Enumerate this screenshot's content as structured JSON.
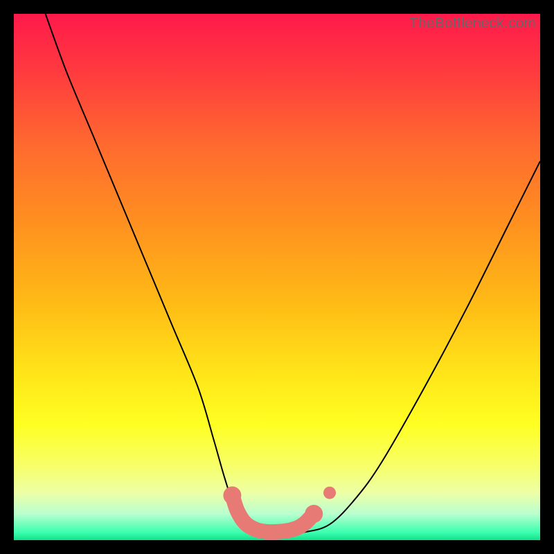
{
  "watermark": {
    "text": "TheBottleneck.com"
  },
  "colors": {
    "curve": "#000000",
    "marker_fill": "#e77a74",
    "marker_stroke": "#e77a74",
    "gradient_stops": [
      {
        "offset": 0.0,
        "color": "#ff1a4b"
      },
      {
        "offset": 0.1,
        "color": "#ff3740"
      },
      {
        "offset": 0.25,
        "color": "#ff6a2f"
      },
      {
        "offset": 0.4,
        "color": "#ff911f"
      },
      {
        "offset": 0.55,
        "color": "#ffbb16"
      },
      {
        "offset": 0.68,
        "color": "#ffe419"
      },
      {
        "offset": 0.78,
        "color": "#ffff22"
      },
      {
        "offset": 0.86,
        "color": "#f7ff6a"
      },
      {
        "offset": 0.91,
        "color": "#edffa6"
      },
      {
        "offset": 0.95,
        "color": "#b9ffcf"
      },
      {
        "offset": 0.985,
        "color": "#3cffaf"
      },
      {
        "offset": 1.0,
        "color": "#12e08b"
      }
    ]
  },
  "chart_data": {
    "type": "line",
    "title": "",
    "xlabel": "",
    "ylabel": "",
    "xlim": [
      0,
      100
    ],
    "ylim": [
      0,
      100
    ],
    "grid": false,
    "legend": false,
    "series": [
      {
        "name": "bottleneck-curve",
        "x": [
          6,
          10,
          15,
          20,
          25,
          30,
          35,
          38,
          40,
          42,
          44,
          46,
          48,
          50,
          55,
          60,
          65,
          70,
          78,
          86,
          94,
          100
        ],
        "y": [
          100,
          89,
          77,
          65,
          53,
          41,
          29,
          19,
          12,
          6,
          3,
          1.5,
          1.2,
          1.2,
          1.5,
          3,
          8,
          15,
          29,
          44,
          60,
          72
        ]
      }
    ],
    "markers": [
      {
        "name": "optimal-range-worm",
        "points": [
          {
            "x": 41.5,
            "y": 8.5
          },
          {
            "x": 42.5,
            "y": 5.5
          },
          {
            "x": 44.0,
            "y": 3.2
          },
          {
            "x": 46.0,
            "y": 2.0
          },
          {
            "x": 48.0,
            "y": 1.6
          },
          {
            "x": 50.0,
            "y": 1.6
          },
          {
            "x": 52.0,
            "y": 1.8
          },
          {
            "x": 54.0,
            "y": 2.4
          },
          {
            "x": 55.5,
            "y": 3.4
          },
          {
            "x": 57.0,
            "y": 5.0
          }
        ]
      },
      {
        "name": "isolated-point",
        "points": [
          {
            "x": 60.0,
            "y": 9.0
          }
        ]
      }
    ]
  }
}
